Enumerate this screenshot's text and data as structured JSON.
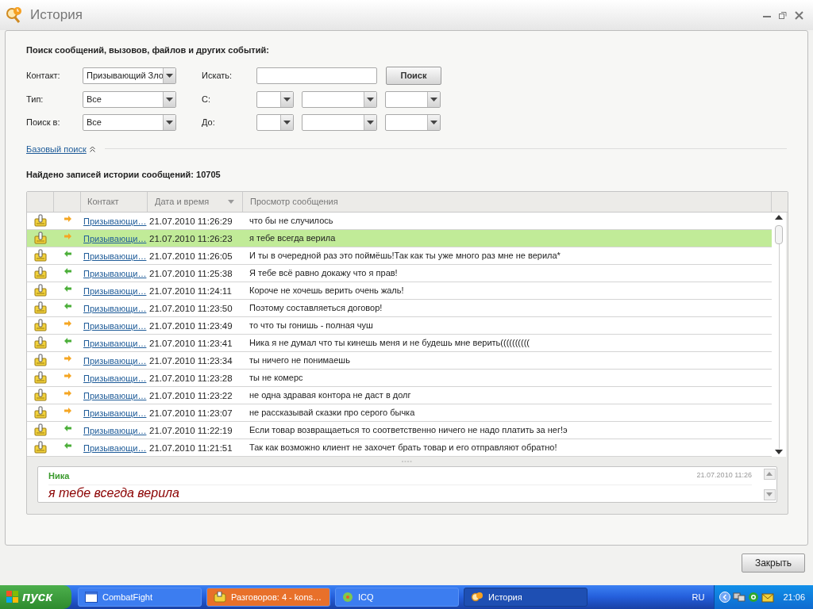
{
  "window": {
    "title": "История"
  },
  "search": {
    "heading": "Поиск сообщений, вызовов, файлов и других событий:",
    "contact_label": "Контакт:",
    "contact_value": "Призывающий Зло",
    "type_label": "Тип:",
    "type_value": "Все",
    "search_in_label": "Поиск в:",
    "search_in_value": "Все",
    "find_label": "Искать:",
    "find_button": "Поиск",
    "from_label": "С:",
    "to_label": "До:",
    "basic_search_link": "Базовый поиск"
  },
  "results_count": "Найдено записей истории сообщений: 10705",
  "table": {
    "columns": [
      "Контакт",
      "Дата и время",
      "Просмотр сообщения"
    ],
    "rows": [
      {
        "kind": "outgoing",
        "contact": "Призывающи…",
        "datetime": "21.07.2010 11:26:29",
        "message": "что бы не случилось",
        "selected": false
      },
      {
        "kind": "outgoing",
        "contact": "Призывающи…",
        "datetime": "21.07.2010 11:26:23",
        "message": "я тебе всегда верила",
        "selected": true
      },
      {
        "kind": "incoming",
        "contact": "Призывающи…",
        "datetime": "21.07.2010 11:26:05",
        "message": "И ты в очередной раз это поймёшь!Так как ты уже много раз мне не верила*",
        "selected": false
      },
      {
        "kind": "incoming",
        "contact": "Призывающи…",
        "datetime": "21.07.2010 11:25:38",
        "message": "Я тебе всё равно докажу что я прав!",
        "selected": false
      },
      {
        "kind": "incoming",
        "contact": "Призывающи…",
        "datetime": "21.07.2010 11:24:11",
        "message": "Короче не хочешь верить очень жаль!",
        "selected": false
      },
      {
        "kind": "incoming",
        "contact": "Призывающи…",
        "datetime": "21.07.2010 11:23:50",
        "message": "Поэтому составляеться договор!",
        "selected": false
      },
      {
        "kind": "outgoing",
        "contact": "Призывающи…",
        "datetime": "21.07.2010 11:23:49",
        "message": "то что ты гонишь - полная чуш",
        "selected": false
      },
      {
        "kind": "incoming",
        "contact": "Призывающи…",
        "datetime": "21.07.2010 11:23:41",
        "message": "Ника я не думал что ты кинешь меня и не будешь мне верить((((((((((",
        "selected": false
      },
      {
        "kind": "outgoing",
        "contact": "Призывающи…",
        "datetime": "21.07.2010 11:23:34",
        "message": "ты ничего не понимаешь",
        "selected": false
      },
      {
        "kind": "outgoing",
        "contact": "Призывающи…",
        "datetime": "21.07.2010 11:23:28",
        "message": "ты не комерс",
        "selected": false
      },
      {
        "kind": "outgoing",
        "contact": "Призывающи…",
        "datetime": "21.07.2010 11:23:22",
        "message": "не одна здравая контора не даст в долг",
        "selected": false
      },
      {
        "kind": "outgoing",
        "contact": "Призывающи…",
        "datetime": "21.07.2010 11:23:07",
        "message": "не рассказывай сказки про серого бычка",
        "selected": false
      },
      {
        "kind": "incoming",
        "contact": "Призывающи…",
        "datetime": "21.07.2010 11:22:19",
        "message": "Если товар возвращаеться то соответственно ничего не надо платить за нег!э",
        "selected": false
      },
      {
        "kind": "incoming",
        "contact": "Призывающи…",
        "datetime": "21.07.2010 11:21:51",
        "message": "Так как возможно клиент не захочет брать товар и его отправляют обратно!",
        "selected": false
      }
    ]
  },
  "preview": {
    "sender": "Ника",
    "datetime": "21.07.2010 11:26",
    "message": "я тебе всегда верила"
  },
  "close_button": "Закрыть",
  "taskbar": {
    "start": "пуск",
    "tasks": [
      {
        "label": "CombatFight",
        "kind": "window",
        "selected": false
      },
      {
        "label": "Разговоров: 4 - kons…",
        "kind": "chat",
        "selected": false
      },
      {
        "label": "ICQ",
        "kind": "icq",
        "selected": false
      },
      {
        "label": "История",
        "kind": "history",
        "selected": true
      }
    ],
    "language": "RU",
    "clock": "21:06"
  }
}
